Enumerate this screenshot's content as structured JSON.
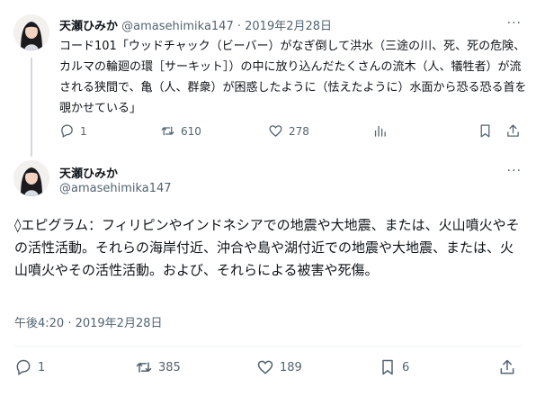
{
  "tweet1": {
    "name": "天瀬ひみか",
    "handle": "@amasehimika147",
    "separator": " · ",
    "date": "2019年2月28日",
    "more": "···",
    "text": "コード101「ウッドチャック（ビーバー）がなぎ倒して洪水（三途の川、死、死の危険、カルマの輪廻の環［サーキット］）の中に放り込んだたくさんの流木（人、犠牲者）が流される狭間で、亀（人、群衆）が困惑したように（怯えたように）水面から恐る恐る首を覗かせている」",
    "actions": {
      "replies": "1",
      "retweets": "610",
      "likes": "278"
    }
  },
  "tweet2": {
    "name": "天瀬ひみか",
    "handle": "@amasehimika147",
    "more": "···",
    "text": "◊エピグラム：フィリピンやインドネシアでの地震や大地震、または、火山噴火やその活性活動。それらの海岸付近、沖合や島や湖付近での地震や大地震、または、火山噴火やその活性活動。および、それらによる被害や死傷。",
    "timestamp": "午後4:20 · 2019年2月28日",
    "actions": {
      "replies": "1",
      "retweets": "385",
      "likes": "189",
      "bookmarks": "6"
    }
  },
  "icons": [
    "reply-icon",
    "retweet-icon",
    "like-icon",
    "views-icon",
    "bookmark-icon",
    "share-icon",
    "more-icon"
  ],
  "colors": {
    "text": "#0f1419",
    "secondary": "#536471",
    "divider": "#eff3f4",
    "thread": "#cfd9de"
  }
}
